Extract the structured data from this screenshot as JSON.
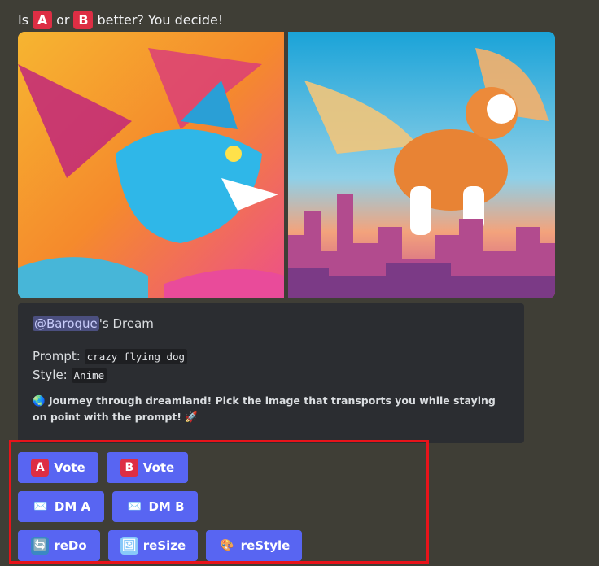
{
  "header": {
    "prefix": "Is",
    "option_a": "A",
    "middle": "or",
    "option_b": "B",
    "suffix": "better? You decide!"
  },
  "images": {
    "a_subject": "winged blue wolf-dog, colorful anime style",
    "b_subject": "winged orange corgi flying over city, anime style"
  },
  "embed": {
    "mention": "@Baroque",
    "title_suffix": "'s Dream",
    "prompt_label": "Prompt:",
    "prompt_value": "crazy flying dog",
    "style_label": "Style:",
    "style_value": "Anime",
    "globe_icon": "🌏",
    "description": "Journey through dreamland! Pick the image that transports you while staying on point with the prompt!",
    "rocket_icon": "🚀"
  },
  "buttons": {
    "vote_a": {
      "glyph": "A",
      "label": "Vote"
    },
    "vote_b": {
      "glyph": "B",
      "label": "Vote"
    },
    "dm_a": {
      "glyph": "✉️",
      "label": "DM A"
    },
    "dm_b": {
      "glyph": "✉️",
      "label": "DM B"
    },
    "redo": {
      "glyph": "🔄",
      "label": "reDo"
    },
    "resize": {
      "glyph": "🖼",
      "label": "reSize"
    },
    "restyle": {
      "glyph": "🎨",
      "label": "reStyle"
    }
  },
  "colors": {
    "background": "#3f3e36",
    "embed_bg": "#2b2d31",
    "button_blurple": "#5865f2",
    "letter_badge_red": "#dd2e44",
    "highlight_border": "#e8131a"
  }
}
